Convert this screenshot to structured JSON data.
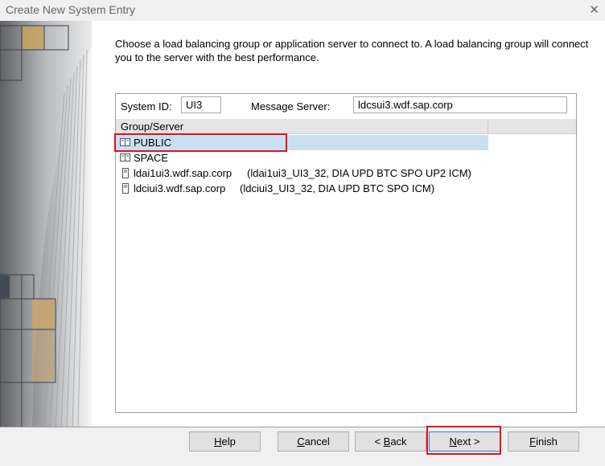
{
  "window": {
    "title": "Create New System Entry"
  },
  "intro_text": "Choose a load balancing group or application server to connect to. A load balancing group will connect you to the server with the best performance.",
  "system_id": {
    "label": "System ID:",
    "value": "UI3"
  },
  "message_server": {
    "label": "Message Server:",
    "value": "ldcsui3.wdf.sap.corp"
  },
  "list": {
    "header": "Group/Server",
    "rows": [
      {
        "icon": "group-icon",
        "name": "PUBLIC",
        "desc": "",
        "selected": true
      },
      {
        "icon": "group-icon",
        "name": "SPACE",
        "desc": ""
      },
      {
        "icon": "server-icon",
        "name": "ldai1ui3.wdf.sap.corp",
        "desc": "(ldai1ui3_UI3_32, DIA UPD BTC SPO UP2 ICM)"
      },
      {
        "icon": "server-icon",
        "name": "ldciui3.wdf.sap.corp",
        "desc": "(ldciui3_UI3_32, DIA UPD BTC SPO ICM)"
      }
    ]
  },
  "buttons": {
    "help": {
      "mnemonic": "H",
      "rest": "elp"
    },
    "cancel": {
      "mnemonic": "C",
      "rest": "ancel"
    },
    "back": {
      "prefix": "< ",
      "mnemonic": "B",
      "rest": "ack"
    },
    "next": {
      "mnemonic": "N",
      "rest": "ext >"
    },
    "finish": {
      "mnemonic": "F",
      "rest": "inish"
    }
  },
  "colors": {
    "selection": "#c8e0f2",
    "highlight_box": "#e2101a",
    "default_button_border": "#2e7fd2"
  }
}
